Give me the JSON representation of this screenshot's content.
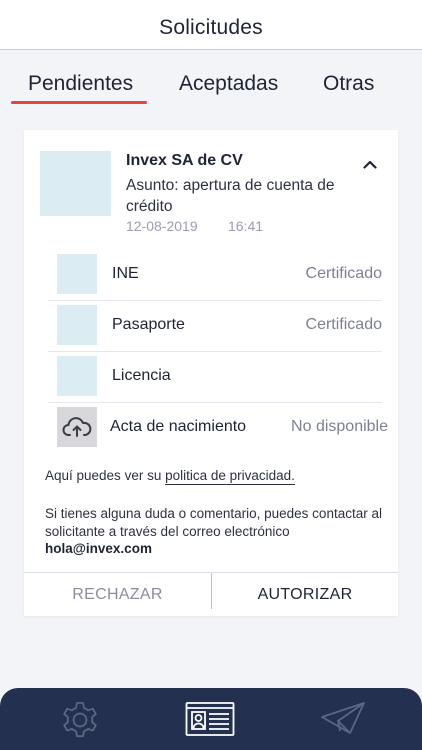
{
  "header": {
    "title": "Solicitudes"
  },
  "tabs": [
    {
      "label": "Pendientes",
      "active": true
    },
    {
      "label": "Aceptadas",
      "active": false
    },
    {
      "label": "Otras",
      "active": false
    }
  ],
  "request": {
    "company": "Invex SA de CV",
    "subject": "Asunto: apertura de cuenta de crédito",
    "date": "12-08-2019",
    "time": "16:41",
    "documents": [
      {
        "name": "INE",
        "status": "Certificado",
        "icon": "image-placeholder"
      },
      {
        "name": "Pasaporte",
        "status": "Certificado",
        "icon": "image-placeholder"
      },
      {
        "name": "Licencia",
        "status": "",
        "icon": "image-placeholder"
      },
      {
        "name": "Acta de nacimiento",
        "status": "No disponible",
        "icon": "cloud-upload-icon"
      }
    ],
    "privacy_prefix": "Aquí puedes ver su ",
    "privacy_link": "politica de privacidad.",
    "contact_text": "Si tienes alguna duda o comentario, puedes contactar al solicitante a través del correo electrónico",
    "email": "hola@invex.com",
    "reject_label": "RECHAZAR",
    "accept_label": "AUTORIZAR"
  },
  "nav": {
    "items": [
      "gear-icon",
      "id-card-icon",
      "paper-plane-icon"
    ],
    "active": "id-card-icon"
  },
  "colors": {
    "accent": "#e0473a",
    "nav_bg": "#23304f",
    "placeholder": "#dcecf3"
  }
}
